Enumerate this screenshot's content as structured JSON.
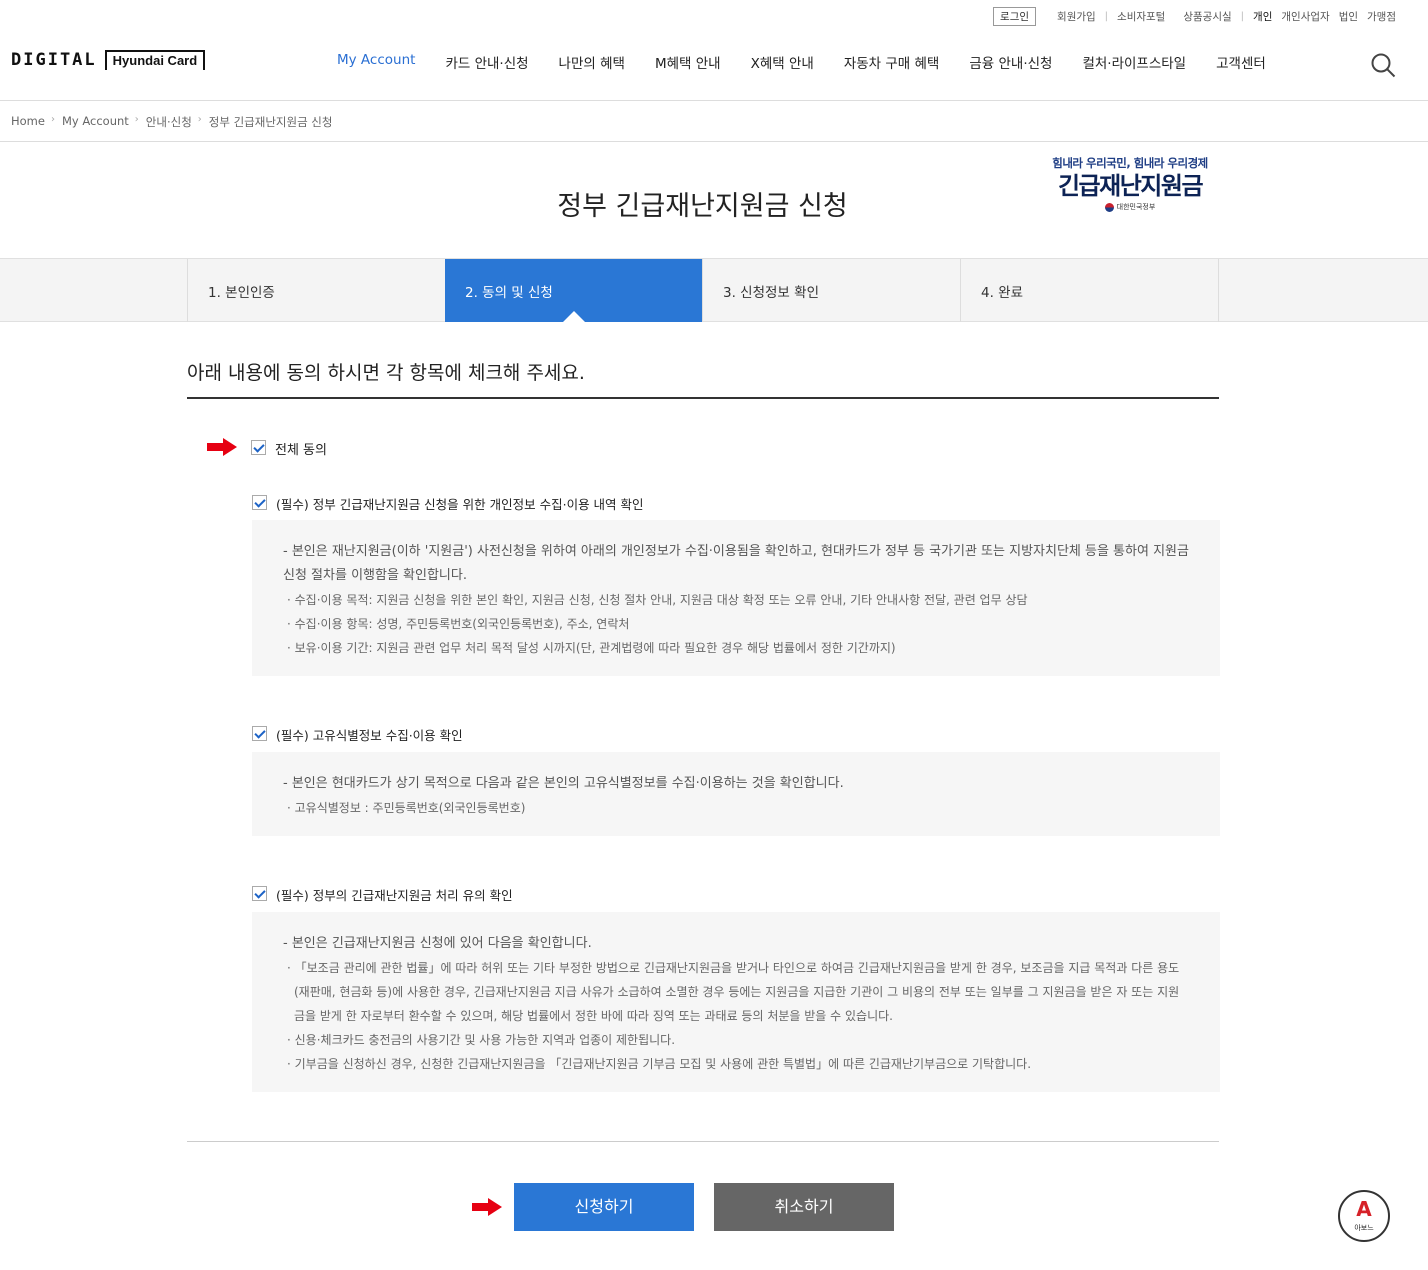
{
  "util": {
    "login": "로그인",
    "join": "회원가입",
    "consumer": "소비자포털",
    "product": "상품공시실",
    "personal": "개인",
    "business": "개인사업자",
    "corporate": "법인",
    "merchant": "가맹점"
  },
  "logo": {
    "digital": "DIGITAL",
    "brand": "Hyundai Card"
  },
  "gnb": [
    "My Account",
    "카드 안내·신청",
    "나만의 혜택",
    "M혜택 안내",
    "X혜택 안내",
    "자동차 구매 혜택",
    "금융 안내·신청",
    "컬처·라이프스타일",
    "고객센터"
  ],
  "breadcrumb": [
    "Home",
    "My Account",
    "안내·신청",
    "정부 긴급재난지원금 신청"
  ],
  "title": "정부 긴급재난지원금 신청",
  "badge": {
    "sub": "힘내라 우리국민, 힘내라 우리경제",
    "main": "긴급재난지원금",
    "gov": "대한민국정부"
  },
  "steps": [
    "1. 본인인증",
    "2. 동의 및 신청",
    "3. 신청정보 확인",
    "4. 완료"
  ],
  "lead": "아래 내용에 동의 하시면 각 항목에 체크해 주세요.",
  "agree_all": "전체 동의",
  "sections": [
    {
      "label": "(필수) 정부 긴급재난지원금 신청을 위한 개인정보 수집·이용 내역 확인",
      "para": "- 본인은 재난지원금(이하 '지원금') 사전신청을 위하여 아래의 개인정보가 수집·이용됨을 확인하고, 현대카드가 정부 등 국가기관 또는 지방자치단체 등을 통하여 지원금 신청 절차를 이행함을 확인합니다.",
      "items": [
        "· 수집·이용 목적: 지원금 신청을 위한 본인 확인, 지원금 신청, 신청 절차 안내, 지원금 대상 확정 또는 오류 안내, 기타 안내사항 전달, 관련 업무 상담",
        "· 수집·이용 항목: 성명, 주민등록번호(외국인등록번호), 주소, 연락처",
        "· 보유·이용 기간: 지원금 관련 업무 처리 목적 달성 시까지(단, 관계법령에 따라 필요한 경우 해당 법률에서 정한 기간까지)"
      ]
    },
    {
      "label": "(필수) 고유식별정보 수집·이용 확인",
      "para": "- 본인은 현대카드가 상기 목적으로 다음과 같은 본인의 고유식별정보를 수집·이용하는 것을 확인합니다.",
      "items": [
        "· 고유식별정보 : 주민등록번호(외국인등록번호)"
      ]
    },
    {
      "label": "(필수) 정부의 긴급재난지원금 처리 유의 확인",
      "para": "- 본인은 긴급재난지원금 신청에 있어 다음을 확인합니다.",
      "items": [
        "· 「보조금 관리에 관한 법률」에 따라 허위 또는 기타 부정한 방법으로 긴급재난지원금을 받거나 타인으로 하여금 긴급재난지원금을 받게 한 경우, 보조금을 지급 목적과 다른 용도(재판매, 현금화 등)에 사용한 경우, 긴급재난지원금 지급 사유가 소급하여 소멸한 경우 등에는 지원금을 지급한 기관이 그 비용의 전부 또는 일부를 그 지원금을 받은 자 또는 지원금을 받게 한 자로부터 환수할 수 있으며, 해당 법률에서 정한 바에 따라 징역 또는 과태료 등의 처분을 받을 수 있습니다.",
        "· 신용·체크카드 충전금의 사용기간 및 사용 가능한 지역과 업종이 제한됩니다.",
        "· 기부금을 신청하신 경우, 신청한 긴급재난지원금을 「긴급재난지원금 기부금 모집 및 사용에 관한 특별법」에 따른 긴급재난기부금으로 기탁합니다."
      ]
    }
  ],
  "buttons": {
    "apply": "신청하기",
    "cancel": "취소하기"
  },
  "abono": {
    "mark": "A",
    "text": "아보느"
  },
  "colors": {
    "accent": "#2a77d5",
    "arrow": "#e60012",
    "cancel": "#666666"
  }
}
